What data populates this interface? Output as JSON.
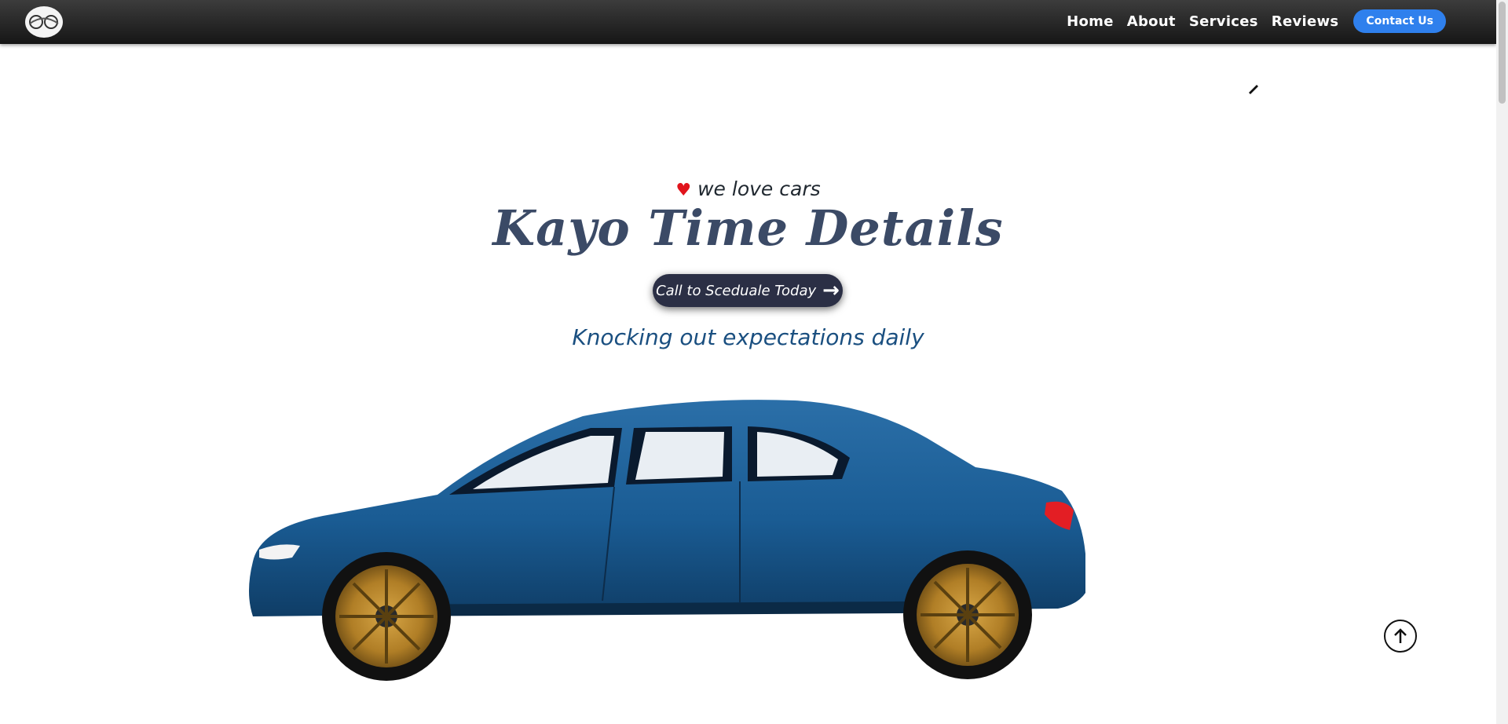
{
  "nav": {
    "logo_icon": "logo-icon",
    "links": [
      "Home",
      "About",
      "Services",
      "Reviews"
    ],
    "contact_label": "Contact Us"
  },
  "hero": {
    "tagline": "we love cars",
    "title": "Kayo Time Details",
    "cta_label": "Call to Sceduale Today",
    "subtitle": "Knocking out expectations daily"
  },
  "colors": {
    "nav_bg": "#1f1f1f",
    "contact_button": "#2f80ed",
    "title": "#3b4a66",
    "cta_bg": "#2b2f45",
    "subtitle": "#1a4f80",
    "heart": "#e1141c",
    "car_body": "#1a5c94",
    "wheel": "#c08a2a"
  },
  "icons": {
    "heart": "heart-icon",
    "arrow": "arrow-right-icon",
    "scroll_top": "arrow-up-circle-icon"
  }
}
